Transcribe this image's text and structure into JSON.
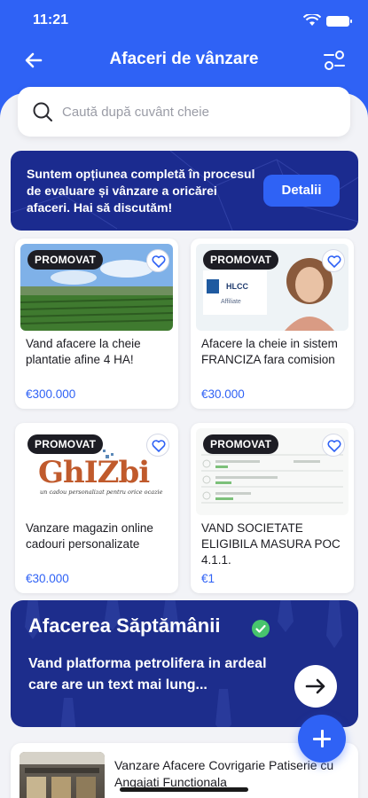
{
  "status_bar": {
    "time": "11:21"
  },
  "header": {
    "title": "Afaceri de vânzare",
    "back_icon": "arrow-left-icon",
    "filter_icon": "sliders-icon"
  },
  "search": {
    "placeholder": "Caută după cuvânt cheie",
    "value": ""
  },
  "promo_banner": {
    "text": "Suntem opțiunea completă în procesul de evaluare și vânzare a oricărei afaceri. Hai să discutăm!",
    "button_label": "Detalii"
  },
  "listings": [
    {
      "badge": "PROMOVAT",
      "title": "Vand afacere la cheie plantatie afine 4 HA!",
      "price": "€300.000"
    },
    {
      "badge": "PROMOVAT",
      "title": "Afacere la cheie in sistem FRANCIZA fara comision",
      "price": "€30.000",
      "logo_text": "HLCC",
      "logo_sub": "Affiliate"
    },
    {
      "badge": "PROMOVAT",
      "title": "Vanzare magazin online cadouri personalizate",
      "price": "€30.000",
      "logo_text": "GhIZbi",
      "logo_tagline": "un cadou personalizat pentru orice ocazie"
    },
    {
      "badge": "PROMOVAT",
      "title": "VAND SOCIETATE ELIGIBILA MASURA POC 4.1.1.",
      "price": "€1"
    }
  ],
  "weekly": {
    "title": "Afacerea Săptămânii",
    "description": "Vand platforma petrolifera in ardeal care are un text mai lung...",
    "go_icon": "arrow-right-icon"
  },
  "list_item": {
    "title": "Vanzare Afacere Covrigarie Patiserie cu Angajati Functionala"
  },
  "colors": {
    "primary": "#2f62f5",
    "banner": "#1b2b8f",
    "badge": "#1d1d24",
    "verified": "#47c46d"
  }
}
